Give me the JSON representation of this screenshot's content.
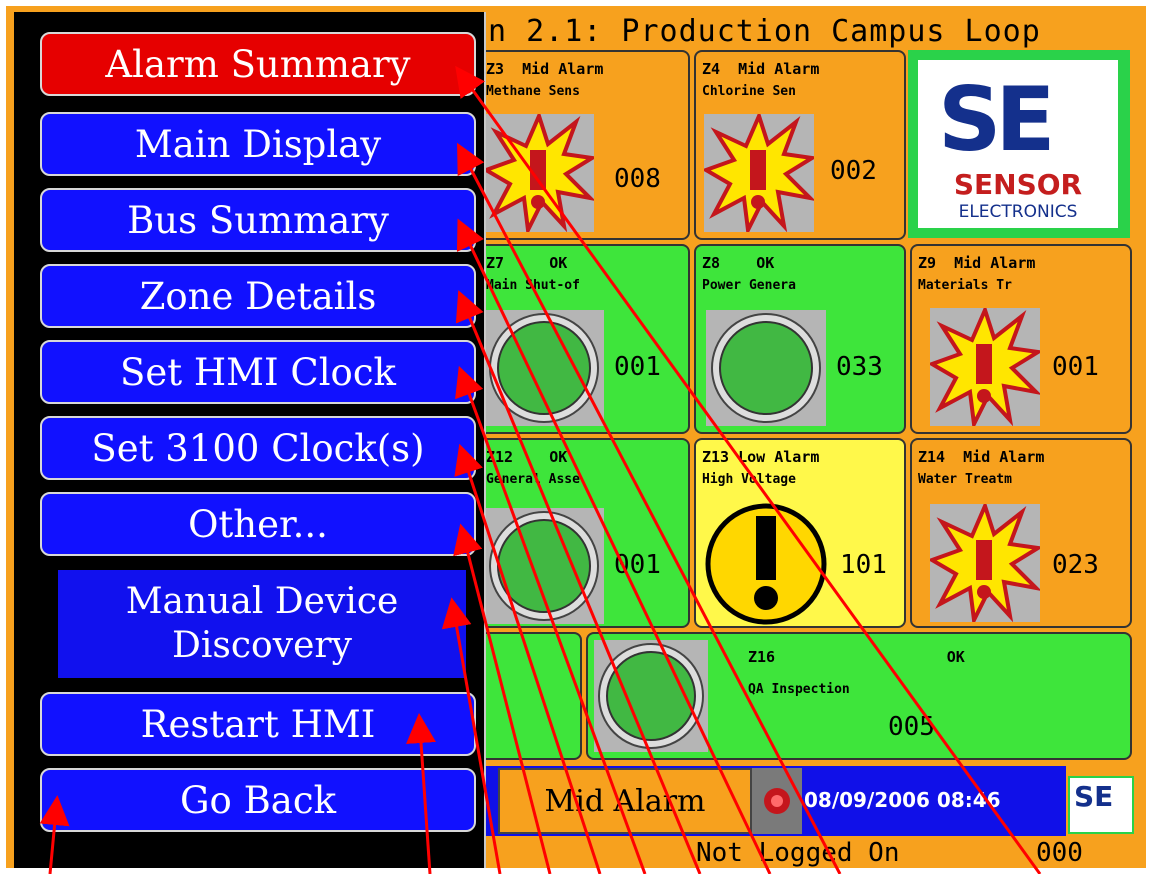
{
  "title": "n 2.1: Production Campus Loop",
  "menu": {
    "items": [
      {
        "label": "Alarm Summary"
      },
      {
        "label": "Main Display"
      },
      {
        "label": "Bus Summary"
      },
      {
        "label": "Zone Details"
      },
      {
        "label": "Set HMI Clock"
      },
      {
        "label": "Set 3100 Clock(s)"
      },
      {
        "label": "Other..."
      },
      {
        "label_line1": "Manual Device",
        "label_line2": "Discovery"
      },
      {
        "label": "Restart HMI"
      },
      {
        "label": "Go Back"
      }
    ]
  },
  "zones": [
    {
      "id": "Z3",
      "status": "Mid Alarm",
      "name": "Methane Sens",
      "count": "008"
    },
    {
      "id": "Z4",
      "status": "Mid Alarm",
      "name": "Chlorine Sen",
      "count": "002"
    },
    {
      "id": "Z7",
      "status": "OK",
      "name": "Main Shut-of",
      "count": "001"
    },
    {
      "id": "Z8",
      "status": "OK",
      "name": "Power Genera",
      "count": "033"
    },
    {
      "id": "Z9",
      "status": "Mid Alarm",
      "name": "Materials Tr",
      "count": "001"
    },
    {
      "id": "Z12",
      "status": "OK",
      "name": "General Asse",
      "count": "001"
    },
    {
      "id": "Z13",
      "status": "Low Alarm",
      "name": "High Voltage",
      "count": "101"
    },
    {
      "id": "Z14",
      "status": "Mid Alarm",
      "name": "Water Treatm",
      "count": "023"
    },
    {
      "id": "Z16",
      "status": "OK",
      "name": "QA Inspection",
      "count": "005"
    }
  ],
  "logo": {
    "big": "SE",
    "line1": "SENSOR",
    "line2": "ELECTRONICS",
    "mini": "SE"
  },
  "status_bar": {
    "alarm_text": "Mid Alarm",
    "datetime": "08/09/2006 08:46",
    "login": "Not Logged On",
    "operator": "000"
  },
  "colors": {
    "alarm_orange": "#f7a11e",
    "ok_green": "#3ee53b",
    "low_yellow": "#fff84a",
    "menu_blue": "#1111ff",
    "menu_red": "#e60000",
    "annotation_red": "#ff0000"
  },
  "icons": {
    "alarm": "explosion-alarm-icon",
    "ok": "green-indicator-icon",
    "low": "exclamation-circle-icon",
    "bell": "alarm-bell-icon"
  }
}
